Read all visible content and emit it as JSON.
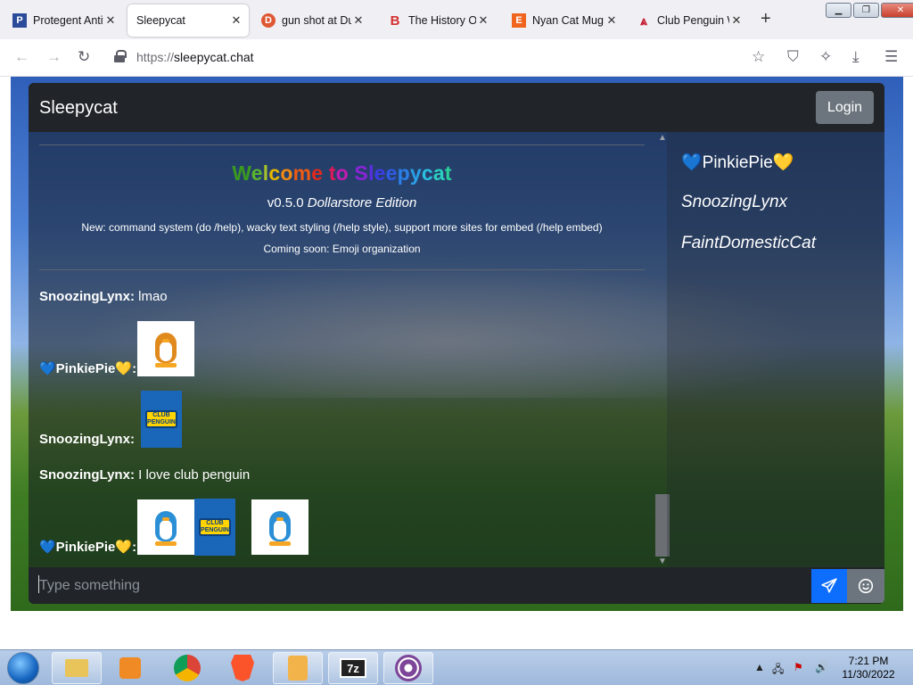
{
  "browser": {
    "tabs": [
      {
        "title": "Protegent Antiv",
        "icon": "protegent-icon",
        "active": false
      },
      {
        "title": "Sleepycat",
        "icon": "",
        "active": true
      },
      {
        "title": "gun shot at Duc",
        "icon": "duckduckgo-icon",
        "active": false
      },
      {
        "title": "The History Of",
        "icon": "blogger-b-icon",
        "active": false
      },
      {
        "title": "Nyan Cat Mug",
        "icon": "etsy-e-icon",
        "active": false
      },
      {
        "title": "Club Penguin W",
        "icon": "fandom-icon",
        "active": false
      }
    ],
    "url_scheme": "https://",
    "url_host": "sleepycat.chat"
  },
  "app": {
    "brand": "Sleepycat",
    "login_label": "Login",
    "welcome": {
      "prefix": "Welcome to ",
      "name": "Sleepycat",
      "version": "v0.5.0",
      "edition": "Dollarstore Edition",
      "news": "New: command system (do /help), wacky text styling (/help style), support more sites for embed (/help embed)",
      "soon": "Coming soon: Emoji organization"
    },
    "messages": [
      {
        "user": "SnoozingLynx",
        "text": "lmao"
      },
      {
        "user": "💙PinkiePie💛",
        "text": ""
      },
      {
        "user": "SnoozingLynx",
        "text": ""
      },
      {
        "user": "SnoozingLynx",
        "text": "I love club penguin"
      },
      {
        "user": "💙PinkiePie💛",
        "text": ""
      }
    ],
    "users": [
      {
        "name": "💙PinkiePie💛",
        "italic": false
      },
      {
        "name": "SnoozingLynx",
        "italic": true
      },
      {
        "name": "FaintDomesticCat",
        "italic": true
      }
    ],
    "input_placeholder": "Type something"
  },
  "taskbar": {
    "time": "7:21 PM",
    "date": "11/30/2022"
  },
  "colors": {
    "navbar_bg": "#212529",
    "login_btn": "#6c757d",
    "send_btn": "#0d6efd",
    "penguin_orange": "#e08a1e",
    "penguin_blue": "#2b8fd6"
  }
}
